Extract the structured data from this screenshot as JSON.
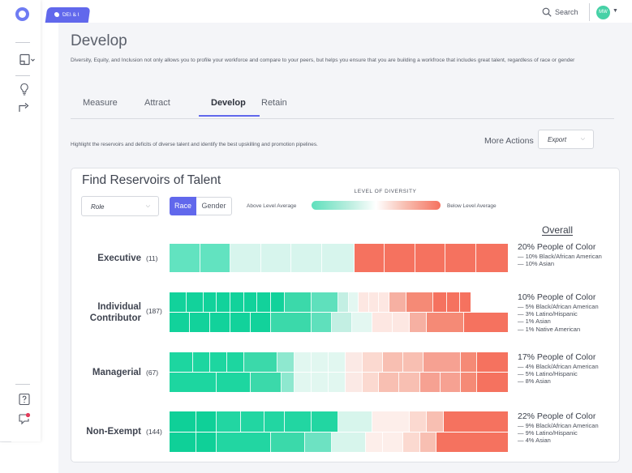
{
  "nav": {
    "logo": "app-logo"
  },
  "topbar": {
    "tag": "DEI & I",
    "search_label": "Search",
    "avatar_initials": "MW"
  },
  "page": {
    "title": "Develop",
    "description": "Diversity, Equity, and Inclusion not only allows you to profile your workforce and compare to your peers, but helps you ensure that you are building a workfroce that includes great talent, regardless of race or gender",
    "tabs": [
      {
        "label": "Measure",
        "active": false
      },
      {
        "label": "Attract",
        "active": false
      },
      {
        "label": "Develop",
        "active": true
      },
      {
        "label": "Retain",
        "active": false
      }
    ],
    "highlight_text": "Highlight the reservoirs and deficits of diverse talent and identify the best upskilling and promotion pipelines.",
    "more_actions_label": "More Actions",
    "export_label": "Export"
  },
  "card": {
    "title": "Find Reservoirs of Talent",
    "role_select_value": "Role",
    "segment": {
      "race": "Race",
      "gender": "Gender",
      "selected": "Race"
    },
    "legend": {
      "title": "LEVEL OF DIVERSITY",
      "above": "Above Level Average",
      "below": "Below Level Average",
      "colors": {
        "above": "#5ee0bc",
        "neutral": "#ffffff",
        "below": "#f5725f"
      }
    },
    "overall_heading": "Overall",
    "rows": [
      {
        "label": "Executive",
        "count": "(11)",
        "summary": "20% People of Color",
        "breakdown": [
          "— 10% Black/African American",
          "— 10% Asian"
        ]
      },
      {
        "label": "Individual Contributor",
        "count": "(187)",
        "summary": "10% People of Color",
        "breakdown": [
          "— 5% Black/African American",
          "— 3% Latino/Hispanic",
          "— 1% Asian",
          "— 1% Native American"
        ]
      },
      {
        "label": "Managerial",
        "count": "(67)",
        "summary": "17% People of Color",
        "breakdown": [
          "— 4% Black/African American",
          "— 5% Latino/Hispanic",
          "— 8% Asian"
        ]
      },
      {
        "label": "Non-Exempt",
        "count": "(144)",
        "summary": "22% People of Color",
        "breakdown": [
          "— 9% Black/African American",
          "— 9% Latino/Hispanic",
          "— 4% Asian"
        ]
      }
    ]
  }
}
